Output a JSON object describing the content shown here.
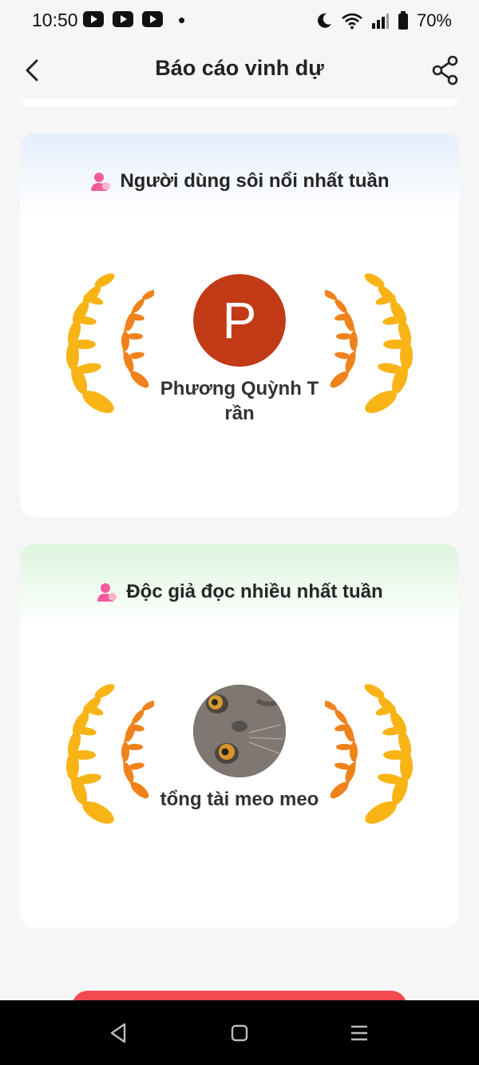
{
  "status_bar": {
    "time": "10:50",
    "battery": "70%",
    "icons": [
      "youtube-icon",
      "youtube-icon",
      "youtube-icon",
      "dot-icon",
      "moon-icon",
      "wifi-icon",
      "signal-icon",
      "battery-icon"
    ]
  },
  "header": {
    "title": "Báo cáo vinh dự",
    "back_icon": "chevron-left-icon",
    "share_icon": "share-icon"
  },
  "cards": [
    {
      "title": "Người dùng sôi nổi nhất tuần",
      "title_icon": "person-icon",
      "background": "#e5eefb",
      "user": {
        "name": "Phương Quỳnh Trần",
        "avatar_letter": "P",
        "avatar_color": "#c23a16"
      }
    },
    {
      "title": "Độc giả đọc nhiều nhất tuần",
      "title_icon": "person-icon",
      "background": "#dcf5dd",
      "user": {
        "name": "tổng tài meo meo",
        "avatar": "cat-photo"
      }
    }
  ],
  "colors": {
    "accent_pink": "#f25c9b",
    "laurel_gold": "#f8b415",
    "laurel_orange": "#f0821c",
    "bottom_button": "#f44a4f"
  },
  "nav_bar": {
    "icons": [
      "back-triangle-icon",
      "home-square-icon",
      "recents-menu-icon"
    ]
  }
}
